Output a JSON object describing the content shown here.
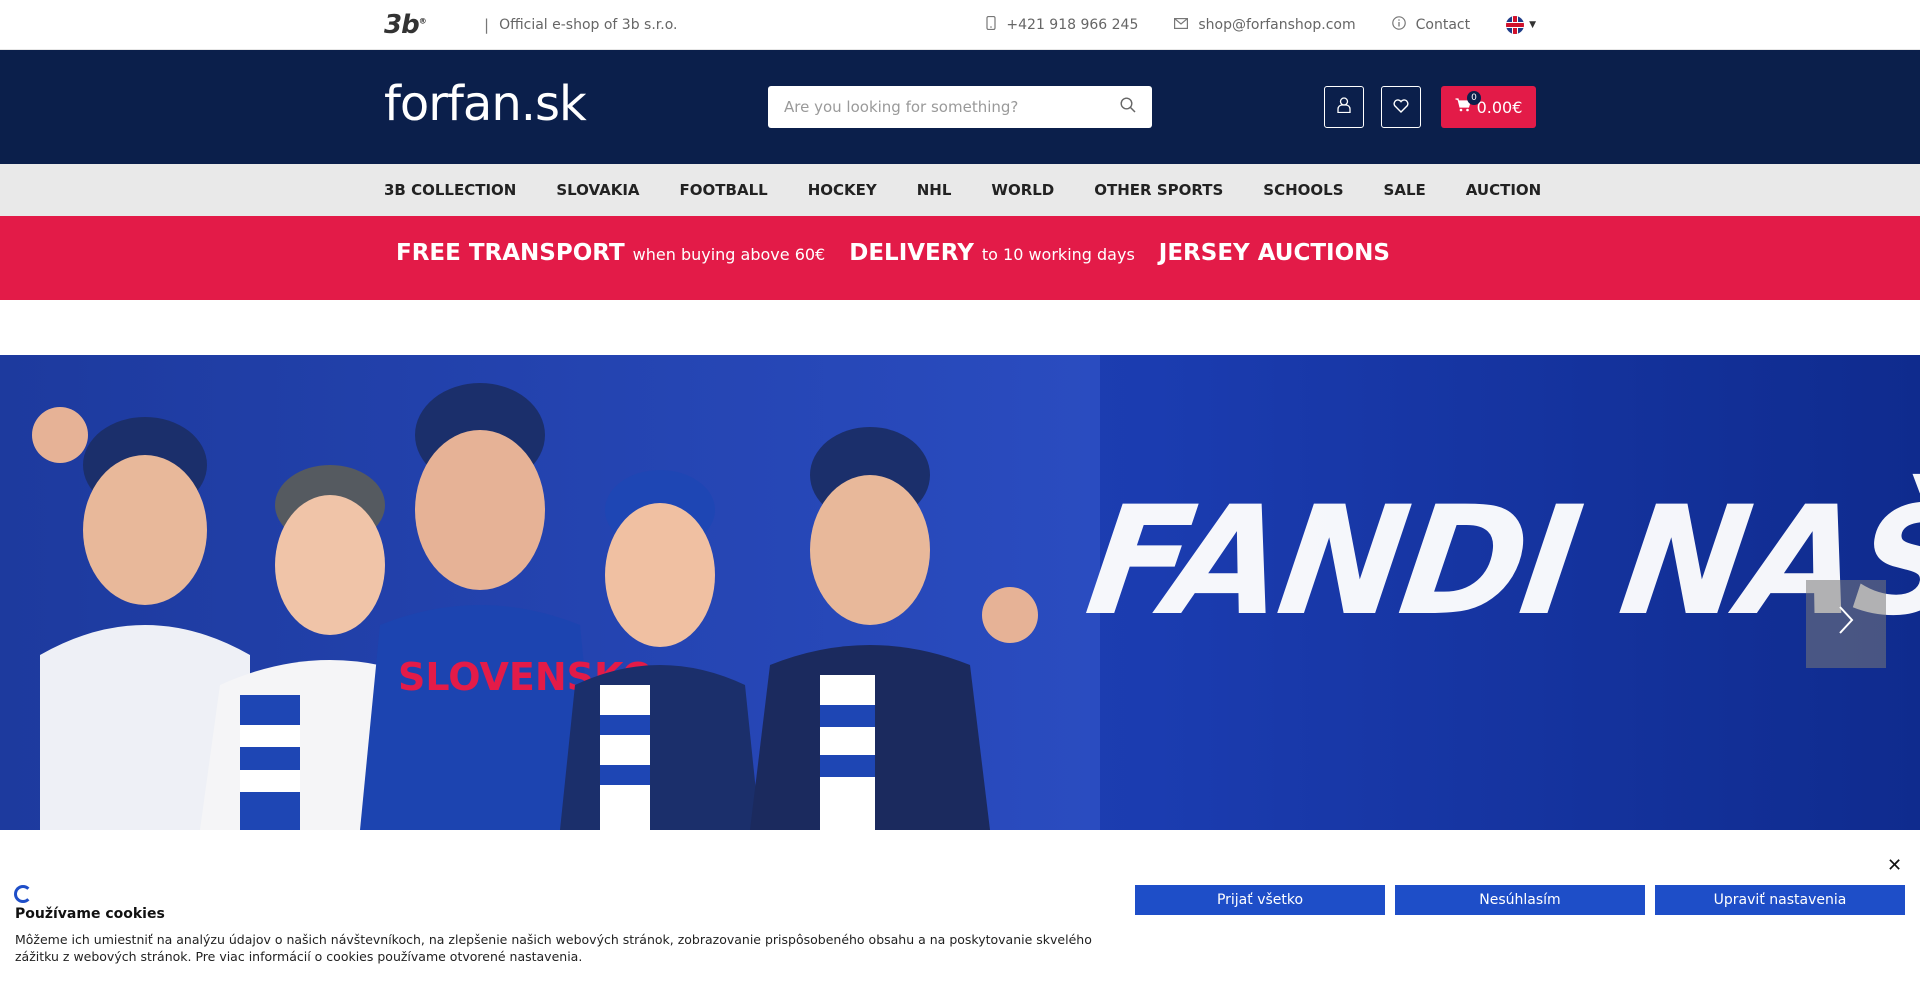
{
  "topbar": {
    "brand": "3b",
    "separator": "|",
    "tagline": "Official e-shop of 3b s.r.o.",
    "phone": "+421 918 966 245",
    "email": "shop@forfanshop.com",
    "contact": "Contact",
    "icons": {
      "phone": "mobile-phone-icon",
      "email": "envelope-icon",
      "contact": "info-icon",
      "language": "uk-flag-icon"
    }
  },
  "header": {
    "logo": "forfan.sk",
    "search_placeholder": "Are you looking for something?",
    "cart_count": "0",
    "cart_total": "0.00€",
    "colors": {
      "header_bg": "#0b1f4b",
      "accent": "#e31b48"
    }
  },
  "nav": {
    "items": [
      "3B COLLECTION",
      "SLOVAKIA",
      "FOOTBALL",
      "HOCKEY",
      "NHL",
      "WORLD",
      "OTHER SPORTS",
      "SCHOOLS",
      "SALE",
      "AUCTION"
    ]
  },
  "promo": {
    "free_transport": "FREE TRANSPORT",
    "free_transport_note": "when buying above 60€",
    "delivery": "DELIVERY",
    "delivery_note": "to 10 working days",
    "auctions": "JERSEY AUCTIONS"
  },
  "hero": {
    "headline": "FANDI NAŠIM",
    "banner_text": "SLOVENSKO"
  },
  "cookie": {
    "title": "Používame cookies",
    "text": "Môžeme ich umiestniť na analýzu údajov o našich návštevníkoch, na zlepšenie našich webových stránok, zobrazovanie prispôsobeného obsahu a na poskytovanie skvelého zážitku z webových stránok. Pre viac informácií o cookies používame otvorené nastavenia.",
    "accept": "Prijať všetko",
    "decline": "Nesúhlasím",
    "settings": "Upraviť nastavenia",
    "colors": {
      "button": "#1e4ec8"
    }
  }
}
